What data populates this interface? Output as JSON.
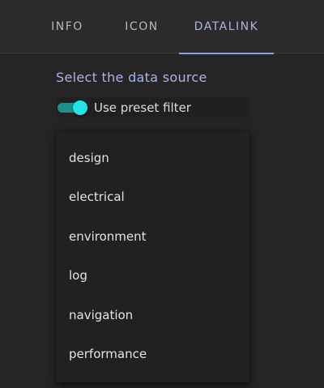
{
  "tabs": [
    {
      "label": "INFO"
    },
    {
      "label": "ICON"
    },
    {
      "label": "DATALINK",
      "active": true
    }
  ],
  "section_title": "Select the data source",
  "preset_filter": {
    "label": "Use preset filter",
    "enabled": true
  },
  "data_sources": [
    "design",
    "electrical",
    "environment",
    "log",
    "navigation",
    "performance"
  ],
  "colors": {
    "accent": "#a8b4ec",
    "toggle_on": "#22e4e8",
    "background": "#252525"
  }
}
